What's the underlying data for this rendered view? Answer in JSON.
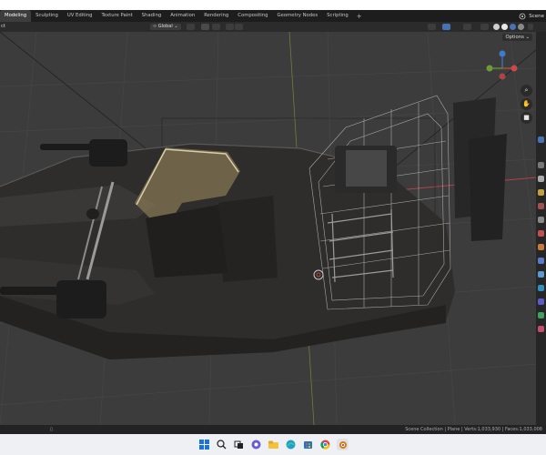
{
  "workspace_tabs": [
    "Modeling",
    "Sculpting",
    "UV Editing",
    "Texture Paint",
    "Shading",
    "Animation",
    "Rendering",
    "Compositing",
    "Geometry Nodes",
    "Scripting"
  ],
  "add_tab": "+",
  "scene": {
    "label": "Scene"
  },
  "header": {
    "left_text": "ct",
    "transform_orientation": "Global",
    "options": "Options"
  },
  "statusbar": {
    "text": "Scene Collection | Plane | Verts:1,033,930 | Faces:1,033,008"
  },
  "colors": {
    "viewport_bg": "#3c3c3c",
    "grid_line": "#464646",
    "axis_red": "#b3424a",
    "axis_green": "#7e9c3a",
    "hull": "#2e2d2c",
    "accent_blue": "#4772b3"
  },
  "icons": {
    "gizmo": "navigation-gizmo",
    "zoom": "zoom-icon",
    "hand": "pan-hand-icon",
    "camera": "camera-view-icon"
  },
  "taskbar": [
    "windows-start-icon",
    "search-icon",
    "task-view-icon",
    "chat-icon",
    "file-explorer-icon",
    "edge-icon",
    "store-icon",
    "chrome-icon",
    "blender-icon"
  ]
}
